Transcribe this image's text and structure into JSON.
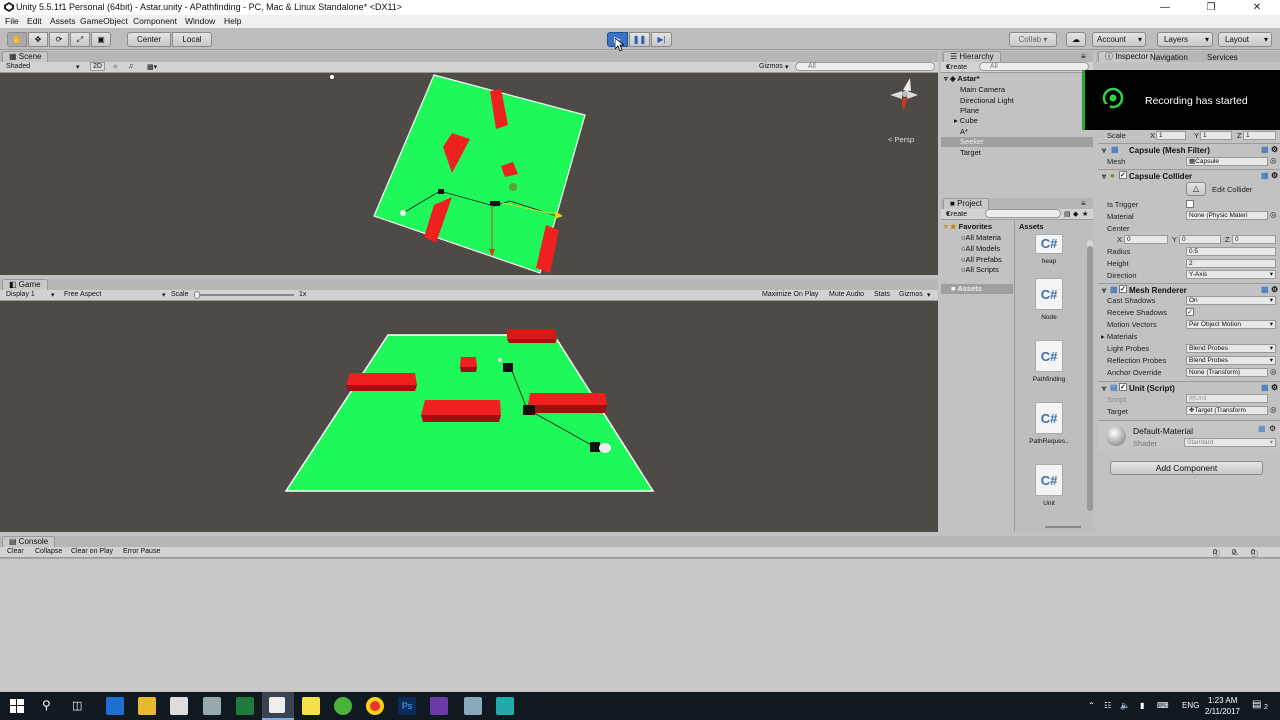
{
  "window": {
    "title": "Unity 5.5.1f1 Personal (64bit) - Astar.unity - APathfinding - PC, Mac & Linux Standalone* <DX11>"
  },
  "menu": [
    "File",
    "Edit",
    "Assets",
    "GameObject",
    "Component",
    "Window",
    "Help"
  ],
  "toolbar": {
    "center": "Center",
    "local": "Local",
    "collab": "Collab ▾",
    "account": "Account",
    "layers": "Layers",
    "layout": "Layout"
  },
  "scene": {
    "tab": "Scene",
    "shaded": "Shaded",
    "mode2d": "2D",
    "gizmos": "Gizmos",
    "search_placeholder": "All",
    "persp": "< Persp"
  },
  "game": {
    "tab": "Game",
    "display": "Display 1",
    "aspect": "Free Aspect",
    "scale_label": "Scale",
    "scale_value": "1x",
    "maximize": "Maximize On Play",
    "mute": "Mute Audio",
    "stats": "Stats",
    "gizmos": "Gizmos"
  },
  "hierarchy": {
    "tab": "Hierarchy",
    "create": "Create",
    "search_placeholder": "All",
    "scene": "Astar*",
    "items": [
      "Main Camera",
      "Directional Light",
      "Plane",
      "Cube",
      "A*",
      "Seeker",
      "Target"
    ],
    "selected": "Seeker"
  },
  "project": {
    "tab": "Project",
    "create": "Create",
    "favorites": "Favorites",
    "fav_items": [
      "All Materia",
      "All Models",
      "All Prefabs",
      "All Scripts"
    ],
    "assets_root": "Assets",
    "assets_header": "Assets",
    "assets": [
      "heap",
      "Node",
      "Pathfinding",
      "PathReques..",
      "Unit"
    ]
  },
  "inspector": {
    "tabs": [
      "Inspector",
      "Navigation",
      "Services"
    ],
    "toast": "Recording has started",
    "scale": {
      "label": "Scale",
      "x": "1",
      "y": "1",
      "z": "1"
    },
    "mesh_filter": {
      "title": "Capsule (Mesh Filter)",
      "mesh_label": "Mesh",
      "mesh_value": "Capsule"
    },
    "collider": {
      "title": "Capsule Collider",
      "edit": "Edit Collider",
      "is_trigger": "Is Trigger",
      "material": "Material",
      "material_value": "None (Physic Materi",
      "center": "Center",
      "cx": "0",
      "cy": "0",
      "cz": "0",
      "radius": "Radius",
      "radius_value": "0.5",
      "height": "Height",
      "height_value": "2",
      "direction": "Direction",
      "direction_value": "Y-Axis"
    },
    "renderer": {
      "title": "Mesh Renderer",
      "cast": "Cast Shadows",
      "cast_value": "On",
      "receive": "Receive Shadows",
      "motion": "Motion Vectors",
      "motion_value": "Per Object Motion",
      "materials": "Materials",
      "light": "Light Probes",
      "light_value": "Blend Probes",
      "reflection": "Reflection Probes",
      "reflection_value": "Blend Probes",
      "anchor": "Anchor Override",
      "anchor_value": "None (Transform)"
    },
    "unit": {
      "title": "Unit (Script)",
      "script": "Script",
      "script_value": "Unit",
      "target": "Target",
      "target_value": "Target (Transform"
    },
    "material": {
      "name": "Default-Material",
      "shader": "Shader",
      "shader_value": "Standard"
    },
    "add_component": "Add Component"
  },
  "console": {
    "tab": "Console",
    "buttons": [
      "Clear",
      "Collapse",
      "Clear on Play",
      "Error Pause"
    ],
    "counts": [
      "0",
      "0",
      "0"
    ]
  },
  "taskbar": {
    "lang": "ENG",
    "time": "1:23 AM",
    "date": "2/11/2017",
    "notif": "2"
  },
  "colors": {
    "ground": "#1ff85a",
    "obstacle": "#ee2020",
    "viewport": "#4e4a45",
    "accent": "#3a72c8"
  }
}
